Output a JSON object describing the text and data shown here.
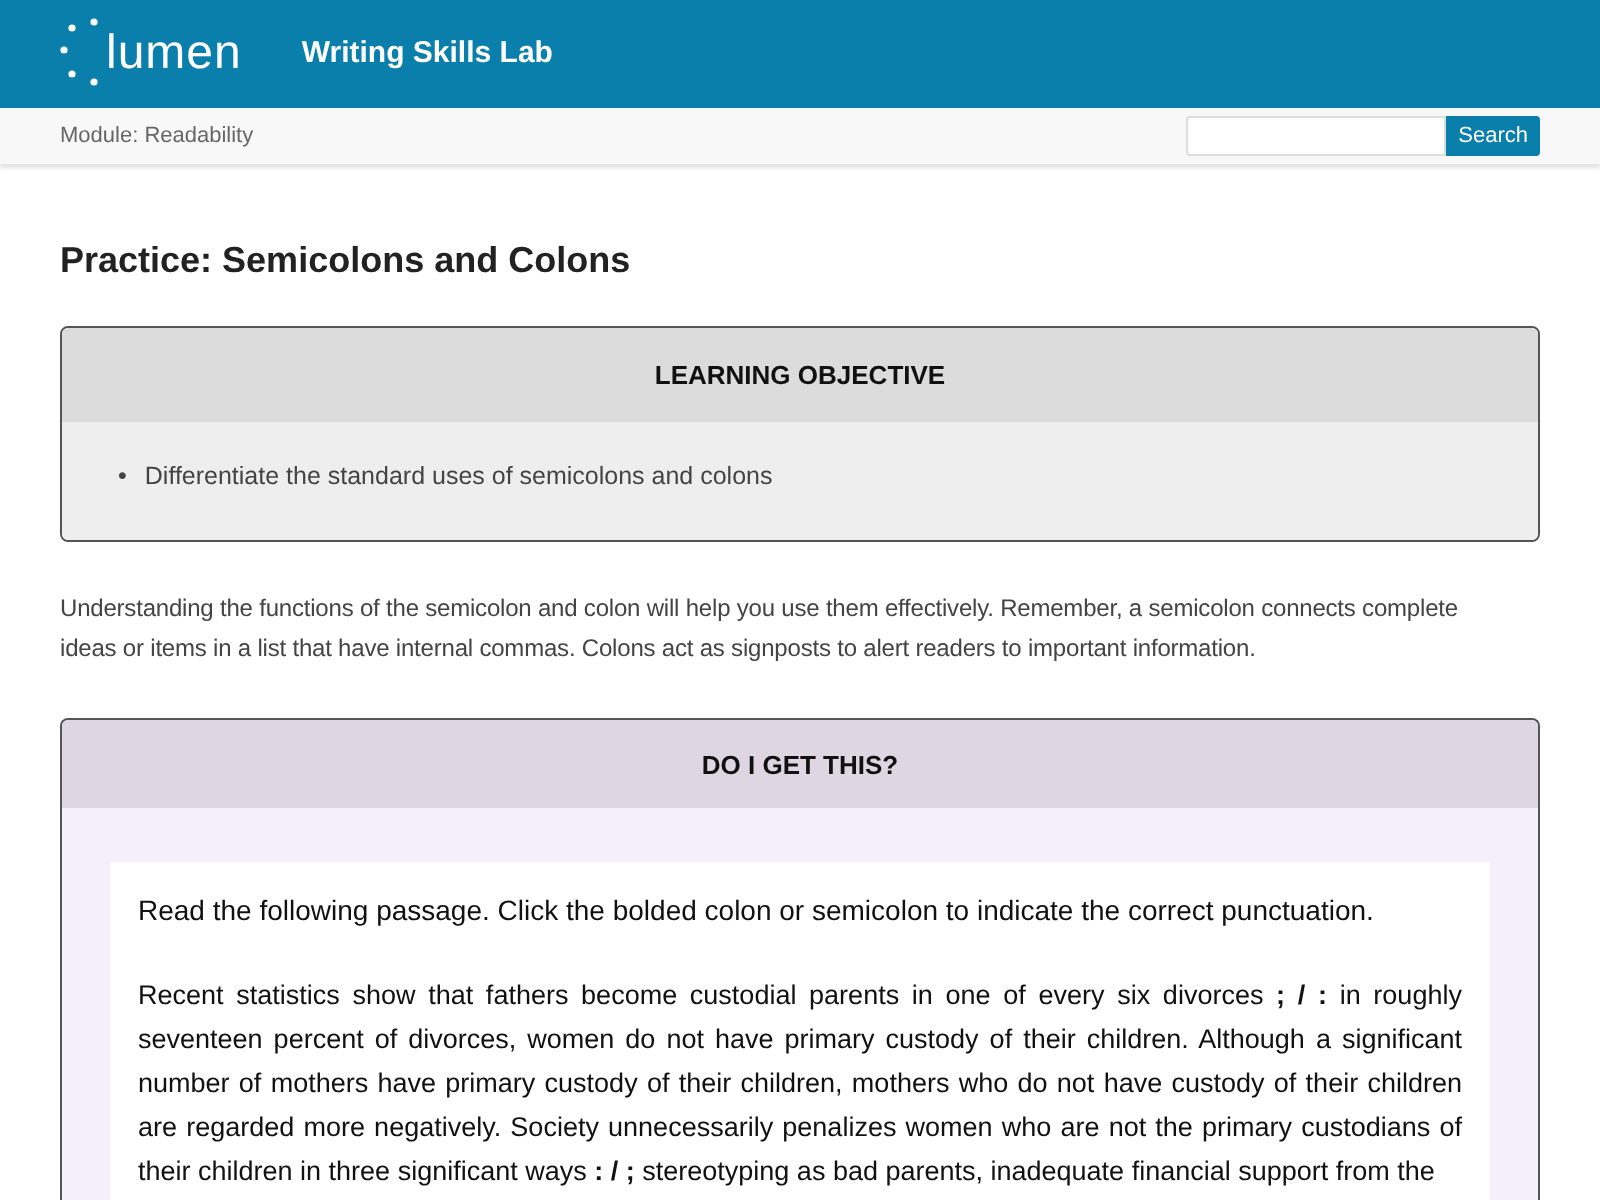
{
  "header": {
    "logo_text": "lumen",
    "title": "Writing Skills Lab"
  },
  "subbar": {
    "breadcrumb": "Module: Readability",
    "search_button": "Search"
  },
  "page_title": "Practice: Semicolons and Colons",
  "learning_objective": {
    "heading": "LEARNING OBJECTIVE",
    "bullet": "•",
    "items": [
      "Differentiate the standard uses of semicolons and colons"
    ]
  },
  "intro": "Understanding the functions of the semicolon and colon will help you use them effectively. Remember, a semicolon connects complete ideas or items in a list that have internal commas. Colons act as signposts to alert readers to important information.",
  "activity": {
    "heading": "DO I GET THIS?",
    "instruction": "Read the following passage. Click the bolded colon or semicolon to indicate the correct punctuation.",
    "passage": [
      {
        "kind": "text",
        "text": "Recent statistics show that fathers become custodial parents in one of every six divorces"
      },
      {
        "kind": "choice",
        "options": [
          ";",
          ":"
        ],
        "separator": "/"
      },
      {
        "kind": "text",
        "text": "in roughly seventeen percent of divorces, women do not have primary custody of their children. Although a significant number of mothers have primary custody of their children, mothers who do not have custody of their children are regarded more negatively. Society unnecessarily penalizes women who are not the primary custodians of their children in three significant ways"
      },
      {
        "kind": "choice",
        "options": [
          ":",
          ";"
        ],
        "separator": "/"
      },
      {
        "kind": "text",
        "text": "stereotyping as bad parents, inadequate financial support from the"
      }
    ]
  }
}
